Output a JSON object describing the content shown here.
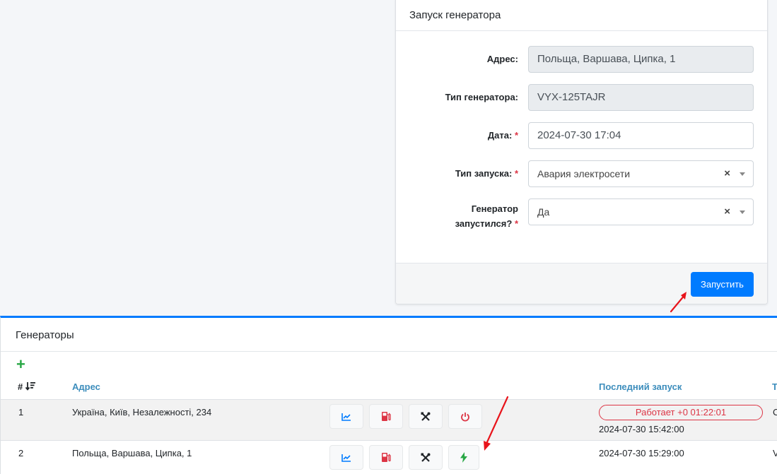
{
  "launch_form": {
    "title": "Запуск генератора",
    "address_label": "Адрес:",
    "address_value": "Польща, Варшава, Ципка, 1",
    "type_label": "Тип генератора:",
    "type_value": "VYX-125TAJR",
    "date_label": "Дата:",
    "date_value": "2024-07-30 17:04",
    "launch_type_label": "Тип запуска:",
    "launch_type_value": "Авария электросети",
    "started_label_1": "Генератор",
    "started_label_2": "запустился?",
    "started_value": "Да",
    "required_mark": "*",
    "clear_glyph": "×",
    "submit_label": "Запустить"
  },
  "generators": {
    "title": "Генераторы",
    "add_glyph": "+",
    "columns": {
      "num": "#",
      "address": "Адрес",
      "last_launch": "Последний запуск",
      "type_partial": "Т"
    },
    "rows": [
      {
        "num": "1",
        "address": "Україна, Київ, Незалежності, 234",
        "status": "Работает +0 01:22:01",
        "last_launch": "2024-07-30 15:42:00",
        "type_partial": "C",
        "power_icon": "power-icon"
      },
      {
        "num": "2",
        "address": "Польща, Варшава, Ципка, 1",
        "last_launch": "2024-07-30 15:29:00",
        "type_partial": "V",
        "power_icon": "bolt-icon"
      }
    ]
  },
  "colors": {
    "primary": "#007bff",
    "danger": "#dc3545",
    "success": "#28a745",
    "link": "#3c8dbc",
    "annotation": "#e8141b"
  }
}
